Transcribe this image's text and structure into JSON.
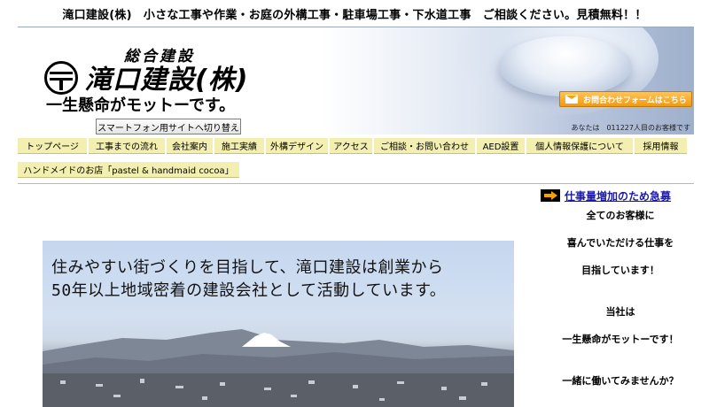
{
  "top_banner": "滝口建設(株)　小さな工事や作業・お庭の外構工事・駐車場工事・下水道工事　ご相談ください。見積無料！！",
  "header": {
    "logo_sub": "総合建設",
    "logo_name": "滝口建設(株)",
    "motto": "一生懸命がモットーです。",
    "smartphone_button": "スマートフォン用サイトへ切り替え",
    "contact_button": "お問合わせフォームはこちら",
    "visitor_count": "あなたは　011227人目のお客様です"
  },
  "nav": {
    "items": [
      "トップページ",
      "工事までの流れ",
      "会社案内",
      "施工実績",
      "外構デザイン",
      "アクセス",
      "ご相談・お問い合わせ",
      "AED設置",
      "個人情報保護について",
      "採用情報"
    ],
    "second_row": "ハンドメイドのお店「pastel & handmaid cocoa」"
  },
  "hero": {
    "line1": "住みやすい街づくりを目指して、滝口建設は創業から",
    "line2": "50年以上地域密着の建設会社として活動しています。"
  },
  "sidebar": {
    "link": "仕事量増加のため急募",
    "lines": [
      "全てのお客様に",
      "喜んでいただける仕事を",
      "目指しています！",
      "当社は",
      "一生懸命がモットーです！",
      "一緒に働いてみませんか？"
    ]
  },
  "colors": {
    "nav_bg": "#f2efb0",
    "contact_orange": "#f09a10",
    "link_blue": "#1a1aa6"
  }
}
